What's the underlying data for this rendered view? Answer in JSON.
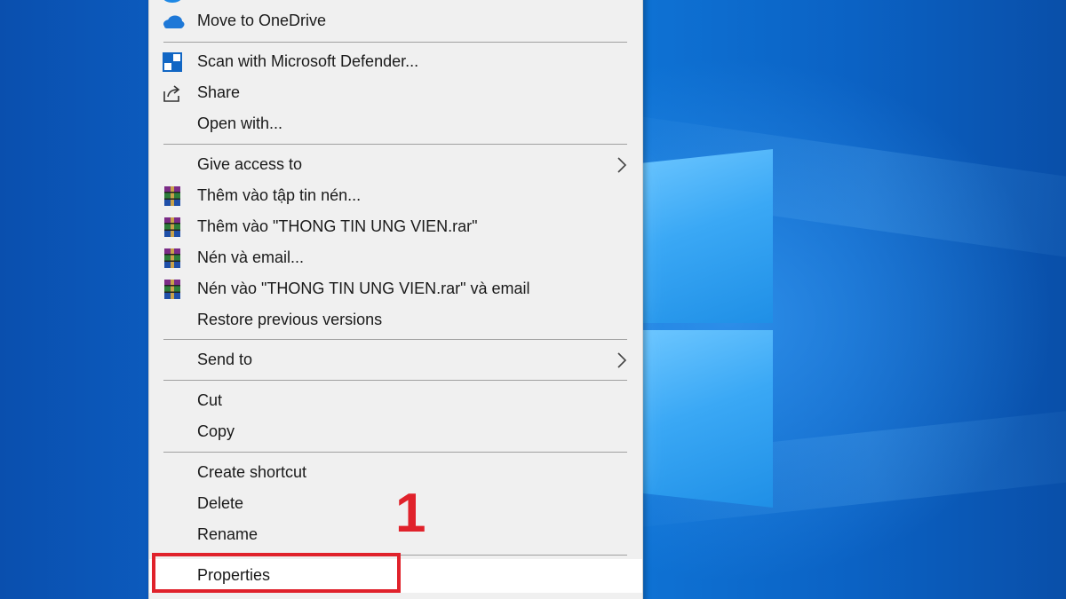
{
  "menu": {
    "items": [
      {
        "id": "move-to-onedrive",
        "label": "Move to OneDrive",
        "icon": "onedrive-cloud-icon"
      },
      {
        "id": "scan-defender",
        "label": "Scan with Microsoft Defender...",
        "icon": "defender-shield-icon"
      },
      {
        "id": "share",
        "label": "Share",
        "icon": "share-icon"
      },
      {
        "id": "open-with",
        "label": "Open with...",
        "icon": ""
      },
      {
        "id": "give-access",
        "label": "Give access to",
        "icon": "",
        "submenu": true
      },
      {
        "id": "winrar-add-archive",
        "label": "Thêm vào tập tin nén...",
        "icon": "winrar-icon"
      },
      {
        "id": "winrar-add-rar",
        "label": "Thêm vào \"THONG TIN UNG VIEN.rar\"",
        "icon": "winrar-icon"
      },
      {
        "id": "winrar-compress-email",
        "label": "Nén và email...",
        "icon": "winrar-icon"
      },
      {
        "id": "winrar-compress-rar-email",
        "label": "Nén vào \"THONG TIN UNG VIEN.rar\" và email",
        "icon": "winrar-icon"
      },
      {
        "id": "restore-previous",
        "label": "Restore previous versions",
        "icon": ""
      },
      {
        "id": "send-to",
        "label": "Send to",
        "icon": "",
        "submenu": true
      },
      {
        "id": "cut",
        "label": "Cut",
        "icon": ""
      },
      {
        "id": "copy",
        "label": "Copy",
        "icon": ""
      },
      {
        "id": "create-shortcut",
        "label": "Create shortcut",
        "icon": ""
      },
      {
        "id": "delete",
        "label": "Delete",
        "icon": ""
      },
      {
        "id": "rename",
        "label": "Rename",
        "icon": ""
      },
      {
        "id": "properties",
        "label": "Properties",
        "icon": "",
        "hovered": true
      }
    ]
  },
  "annotation": {
    "step_number": "1",
    "color": "#e0222b"
  },
  "colors": {
    "menu_background": "#f0f0f0",
    "desktop_accent": "#0f76d8"
  }
}
